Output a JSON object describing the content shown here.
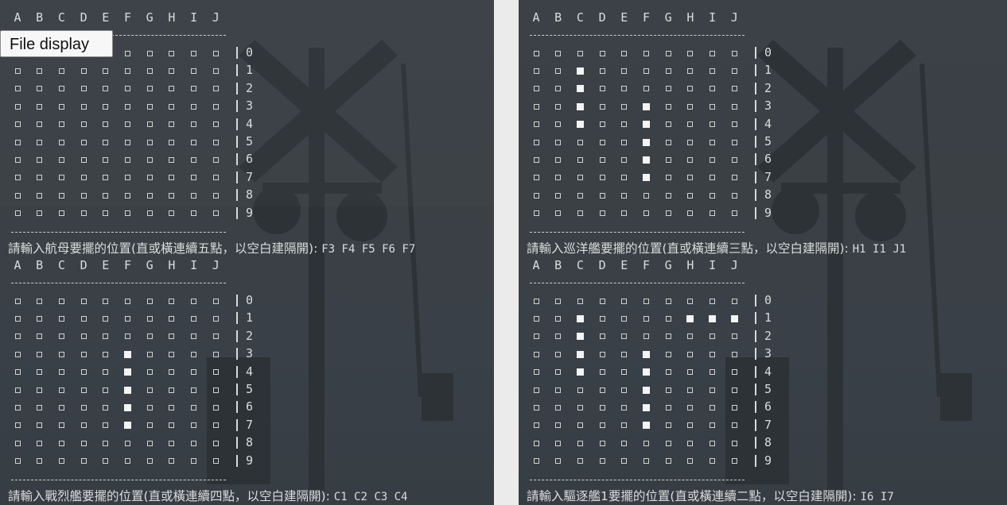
{
  "tooltip": "File display",
  "col_headers": [
    "A",
    "B",
    "C",
    "D",
    "E",
    "F",
    "G",
    "H",
    "I",
    "J"
  ],
  "row_labels": [
    "0",
    "1",
    "2",
    "3",
    "4",
    "5",
    "6",
    "7",
    "8",
    "9"
  ],
  "cell_symbol": "□",
  "filled_symbol": "■",
  "panels": [
    {
      "id": "left",
      "boards": [
        {
          "filled": [],
          "prompt": "請輸入航母要擺的位置(直或橫連續五點，以空白建隔開): ",
          "answer": "F3 F4 F5 F6 F7"
        },
        {
          "filled": [
            "F3",
            "F4",
            "F5",
            "F6",
            "F7"
          ],
          "prompt": "請輸入戰烈艦要擺的位置(直或橫連續四點，以空白建隔開): ",
          "answer": "C1 C2 C3 C4"
        }
      ]
    },
    {
      "id": "right",
      "boards": [
        {
          "filled": [
            "C1",
            "C2",
            "C3",
            "C4",
            "F3",
            "F4",
            "F5",
            "F6",
            "F7"
          ],
          "prompt": "請輸入巡洋艦要擺的位置(直或橫連續三點，以空白建隔開): ",
          "answer": "H1 I1 J1"
        },
        {
          "filled": [
            "C1",
            "C2",
            "C3",
            "C4",
            "F3",
            "F4",
            "F5",
            "F6",
            "F7",
            "H1",
            "I1",
            "J1"
          ],
          "prompt": "請輸入驅逐艦1要擺的位置(直或橫連續二點，以空白建隔開): ",
          "answer": "I6 I7"
        }
      ]
    }
  ]
}
